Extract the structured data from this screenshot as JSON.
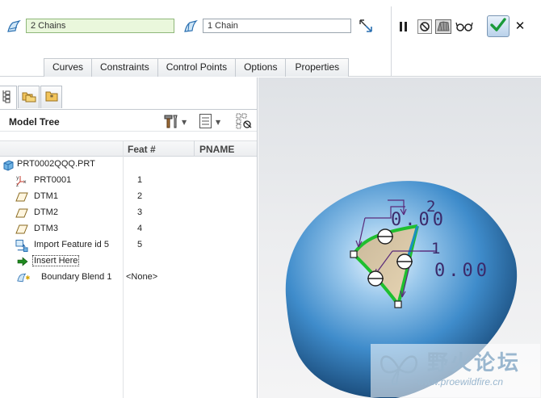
{
  "dashboard": {
    "first_chain_value": "2 Chains",
    "second_chain_value": "1 Chain",
    "tabs": [
      {
        "label": "Curves"
      },
      {
        "label": "Constraints"
      },
      {
        "label": "Control Points"
      },
      {
        "label": "Options"
      },
      {
        "label": "Properties"
      }
    ],
    "icons": {
      "first_chain": "first-direction-chain-icon",
      "second_chain": "second-direction-chain-icon",
      "swap": "swap-direction-icon",
      "pause": "pause-icon",
      "no_preview": "no-preview-icon",
      "preview": "preview-icon",
      "verify": "verify-glasses-icon",
      "ok": "checkmark-icon",
      "cancel": "close-icon"
    },
    "accent_ok_color": "#1a9a3a"
  },
  "navigator": {
    "title": "Model Tree",
    "columns": {
      "feat": "Feat #",
      "pname": "PNAME"
    },
    "rows": [
      {
        "label": "PRT0002QQQ.PRT",
        "feat": "",
        "icon": "part-icon"
      },
      {
        "label": "PRT0001",
        "feat": "1",
        "icon": "csys-icon"
      },
      {
        "label": "DTM1",
        "feat": "2",
        "icon": "datum-plane-icon"
      },
      {
        "label": "DTM2",
        "feat": "3",
        "icon": "datum-plane-icon"
      },
      {
        "label": "DTM3",
        "feat": "4",
        "icon": "datum-plane-icon"
      },
      {
        "label": "Import Feature id 5",
        "feat": "5",
        "icon": "import-feature-icon"
      },
      {
        "label": "Insert Here",
        "feat": "",
        "icon": "insert-arrow-icon"
      },
      {
        "label": "Boundary Blend 1",
        "feat": "<None>",
        "icon": "boundary-blend-icon"
      }
    ]
  },
  "graphics": {
    "dimension_labels": [
      "2",
      "0.00",
      "1",
      "0.00"
    ],
    "chain_color": "#1fbf2f",
    "surface_color": "#2b78b8"
  },
  "watermark": {
    "text": "野火论坛",
    "url": "www.proewildfire.cn"
  }
}
